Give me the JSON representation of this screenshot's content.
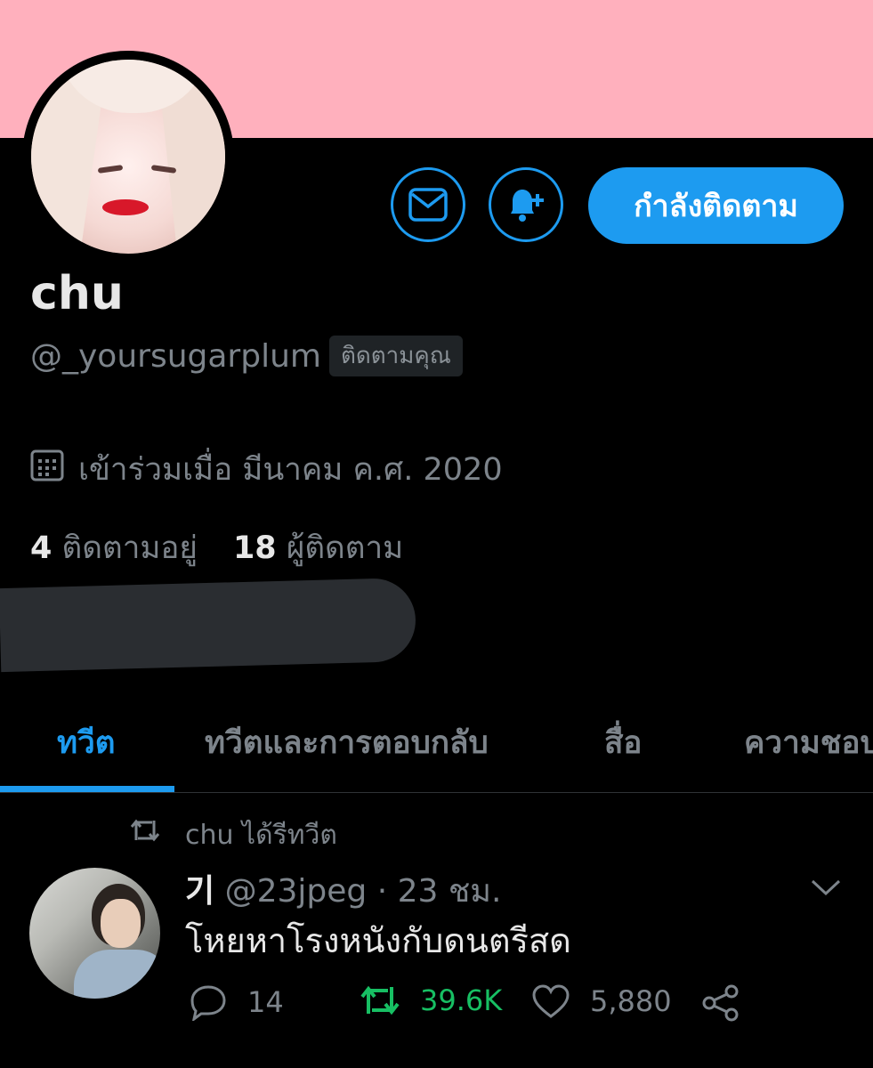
{
  "profile": {
    "name": "chu",
    "handle": "@_yoursugarplum",
    "follows_you": "ติดตามคุณ",
    "joined": "เข้าร่วมเมื่อ มีนาคม ค.ศ. 2020",
    "following_count": "4",
    "following_label": "ติดตามอยู่",
    "followers_count": "18",
    "followers_label": "ผู้ติดตาม"
  },
  "actions": {
    "following_button": "กำลังติดตาม",
    "message_icon": "mail-icon",
    "notify_icon": "bell-plus-icon"
  },
  "tabs": [
    {
      "label": "ทวีต",
      "active": true
    },
    {
      "label": "ทวีตและการตอบกลับ"
    },
    {
      "label": "สื่อ"
    },
    {
      "label": "ความชอบ"
    }
  ],
  "tweet": {
    "retweeted_by": "chu ได้รีทวีต",
    "author_name": "기",
    "author_handle": "@23jpeg",
    "separator": "·",
    "time": "23 ชม.",
    "text": "โหยหาโรงหนังกับดนตรีสด",
    "replies": "14",
    "retweets": "39.6K",
    "likes": "5,880"
  },
  "colors": {
    "banner": "#ffb0bd",
    "accent": "#1d9bf0",
    "retweet_green": "#17bf63",
    "muted": "#7d848b"
  }
}
